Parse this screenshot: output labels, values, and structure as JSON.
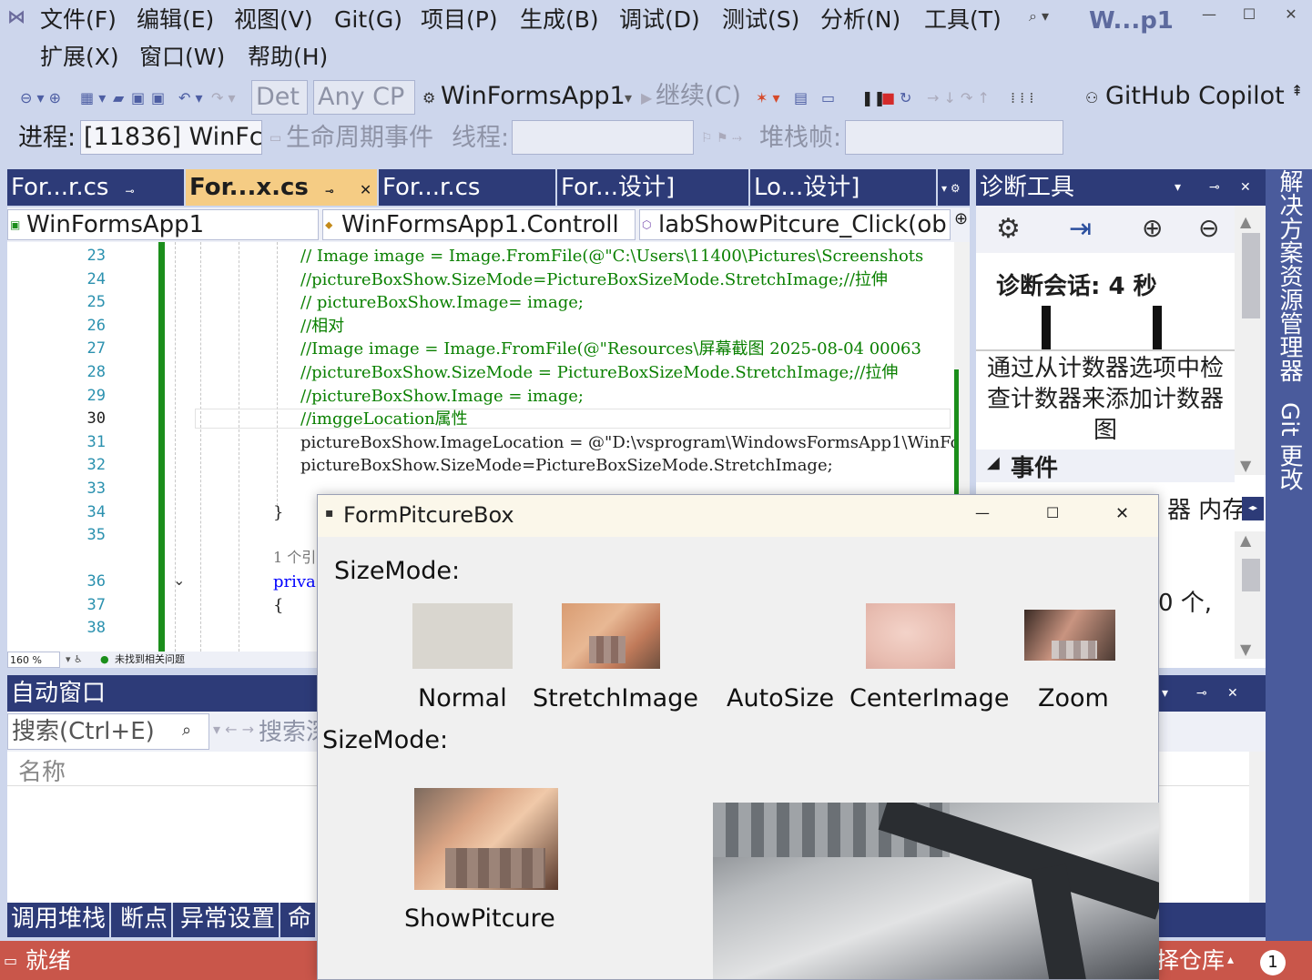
{
  "menu": {
    "row1": [
      "文件(F)",
      "编辑(E)",
      "视图(V)",
      "Git(G)",
      "项目(P)",
      "生成(B)",
      "调试(D)",
      "测试(S)",
      "分析(N)",
      "工具(T)"
    ],
    "row2": [
      "扩展(X)",
      "窗口(W)",
      "帮助(H)"
    ],
    "solution_name": "W...p1"
  },
  "toolbar": {
    "config": "Det",
    "platform": "Any CP",
    "startup_project": "WinFormsApp1",
    "continue": "继续(C)",
    "copilot": "GitHub Copilot"
  },
  "debug_bar": {
    "process_label": "进程:",
    "process_value": "[11836] WinFc",
    "lifecycle": "生命周期事件",
    "thread_label": "线程:",
    "stack_label": "堆栈帧:"
  },
  "editor_tabs": [
    "For...r.cs",
    "For...x.cs",
    "For...r.cs",
    "For...设计]",
    "Lo...设计]"
  ],
  "nav": {
    "project": "WinFormsApp1",
    "class": "WinFormsApp1.Controll",
    "member": "labShowPitcure_Click(ob"
  },
  "code_lines": [
    {
      "num": "23",
      "text": "// Image image = Image.FromFile(@\"C:\\Users\\11400\\Pictures\\Screenshots",
      "comment": true
    },
    {
      "num": "24",
      "text": "//pictureBoxShow.SizeMode=PictureBoxSizeMode.StretchImage;//拉伸",
      "comment": true
    },
    {
      "num": "25",
      "text": "// pictureBoxShow.Image= image;",
      "comment": true
    },
    {
      "num": "26",
      "text": " //相对",
      "comment": true
    },
    {
      "num": "27",
      "text": " //Image image = Image.FromFile(@\"Resources\\屏幕截图 2025-08-04 00063",
      "comment": true
    },
    {
      "num": "28",
      "text": " //pictureBoxShow.SizeMode = PictureBoxSizeMode.StretchImage;//拉伸",
      "comment": true
    },
    {
      "num": "29",
      "text": " //pictureBoxShow.Image = image;",
      "comment": true
    },
    {
      "num": "30",
      "text": " //imggeLocation属性",
      "comment": true
    },
    {
      "num": "31",
      "text": " pictureBoxShow.ImageLocation = @\"D:\\vsprogram\\WindowsFormsApp1\\WinFo",
      "comment": false
    },
    {
      "num": "32",
      "text": " pictureBoxShow.SizeMode=PictureBoxSizeMode.StretchImage;",
      "comment": false
    },
    {
      "num": "33",
      "text": "",
      "comment": false
    },
    {
      "num": "34",
      "text": "}",
      "comment": false
    },
    {
      "num": "35",
      "text": "",
      "comment": false
    },
    {
      "num": "",
      "text": "1 个引",
      "comment": false
    },
    {
      "num": "36",
      "text": "priva",
      "comment": false
    },
    {
      "num": "37",
      "text": "{",
      "comment": false
    },
    {
      "num": "38",
      "text": "",
      "comment": false
    }
  ],
  "editor_status": {
    "zoom": "160 %",
    "issues": "未找到相关问题"
  },
  "diag": {
    "title": "诊断工具",
    "session": "诊断会话: 4 秒",
    "hint": "通过从计数器选项中检查计数器来添加计数器图",
    "events": "事件",
    "tabs_partial": "器  内存",
    "count_partial": "0 个,"
  },
  "right_strip": {
    "solution_explorer": "解决方案资源管理器",
    "git_changes": "Git 更改"
  },
  "autowin": {
    "title": "自动窗口",
    "search_placeholder": "搜索(Ctrl+E)",
    "search_depth": "搜索深",
    "col_name": "名称"
  },
  "bottom_tabs": [
    "调用堆栈",
    "断点",
    "异常设置",
    "命"
  ],
  "status": {
    "ready": "就绪",
    "repo": "择仓库",
    "badge": "1"
  },
  "form": {
    "title": "FormPitcureBox",
    "sizemode_label": "SizeMode:",
    "sizemode_label2": "SizeMode:",
    "modes": [
      "Normal",
      "StretchImage",
      "AutoSize",
      "CenterImage",
      "Zoom"
    ],
    "show_label": "ShowPitcure"
  }
}
